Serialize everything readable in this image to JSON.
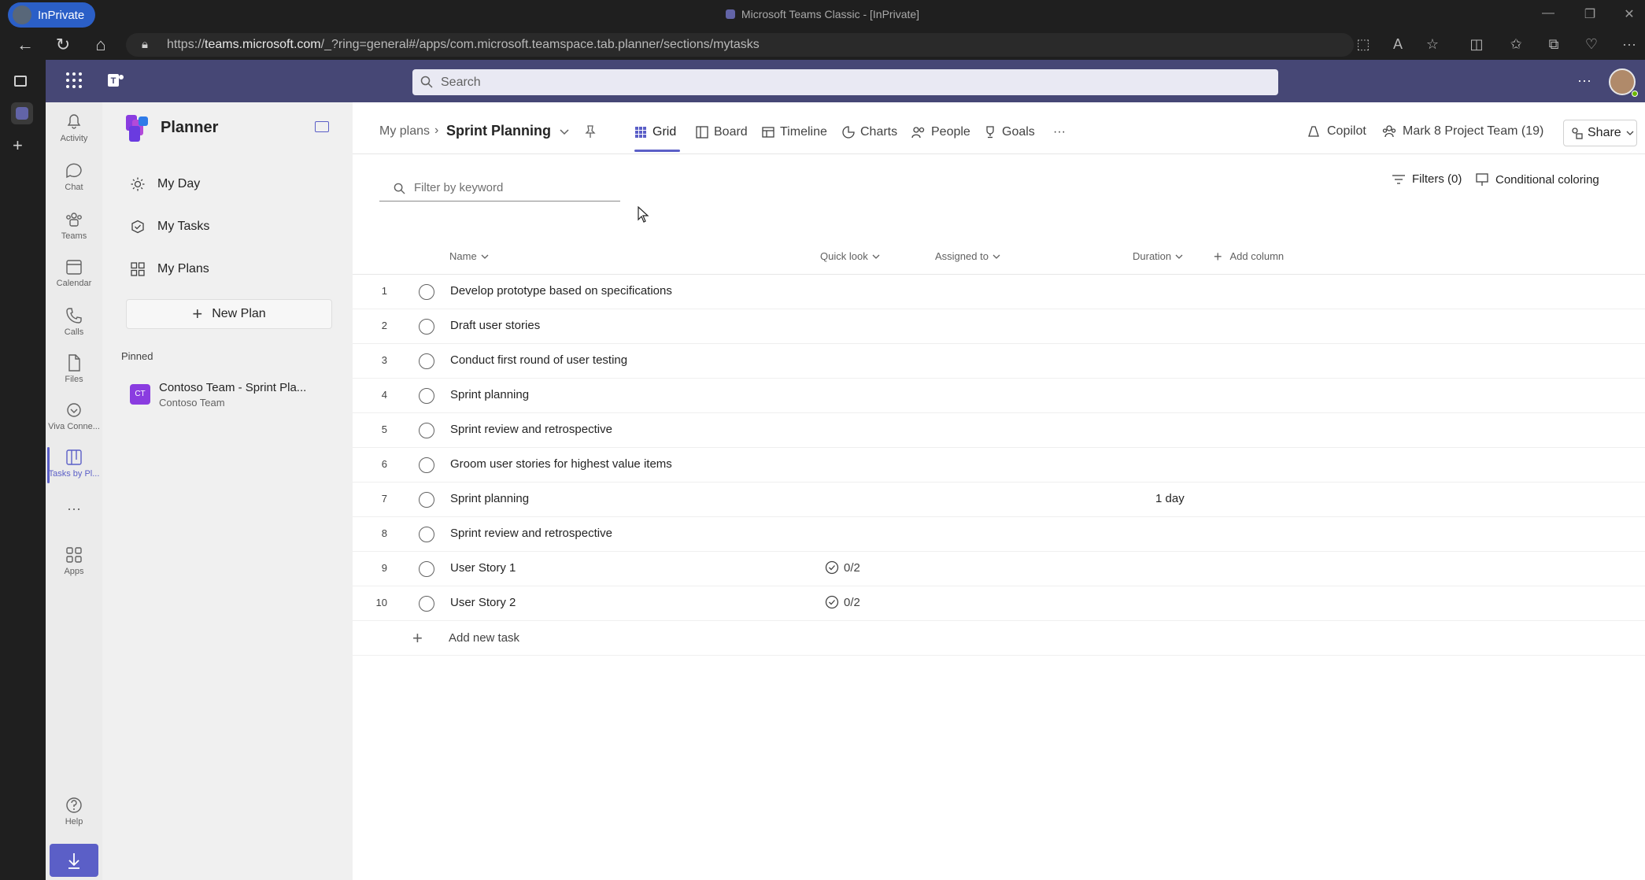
{
  "browser": {
    "inprivate_label": "InPrivate",
    "window_title": "Microsoft Teams Classic - [InPrivate]",
    "url_prefix": "https://",
    "url_host": "teams.microsoft.com",
    "url_path": "/_?ring=general#/apps/com.microsoft.teamspace.tab.planner/sections/mytasks"
  },
  "teams": {
    "search_placeholder": "Search",
    "rail": [
      {
        "label": "Activity",
        "icon": "bell-icon"
      },
      {
        "label": "Chat",
        "icon": "chat-icon"
      },
      {
        "label": "Teams",
        "icon": "teams-icon"
      },
      {
        "label": "Calendar",
        "icon": "calendar-icon"
      },
      {
        "label": "Calls",
        "icon": "phone-icon"
      },
      {
        "label": "Files",
        "icon": "file-icon"
      },
      {
        "label": "Viva Conne...",
        "icon": "viva-icon"
      },
      {
        "label": "Tasks by Pl...",
        "icon": "tasks-icon"
      },
      {
        "label": "Apps",
        "icon": "apps-icon"
      },
      {
        "label": "Help",
        "icon": "help-icon"
      }
    ],
    "more_label": "···"
  },
  "sidebar": {
    "app_title": "Planner",
    "nav": [
      {
        "label": "My Day",
        "icon": "sun-icon"
      },
      {
        "label": "My Tasks",
        "icon": "tasks-icon"
      },
      {
        "label": "My Plans",
        "icon": "grid-icon"
      }
    ],
    "new_plan_label": "New Plan",
    "pinned_heading": "Pinned",
    "pinned_item": {
      "title": "Contoso Team - Sprint Pla...",
      "subtitle": "Contoso Team",
      "badge": "CT"
    }
  },
  "header": {
    "breadcrumb_root": "My plans",
    "plan_title": "Sprint Planning",
    "tabs": [
      "Grid",
      "Board",
      "Timeline",
      "Charts",
      "People",
      "Goals"
    ],
    "more": "···",
    "copilot_label": "Copilot",
    "team_label": "Mark 8 Project Team (19)",
    "share_label": "Share"
  },
  "toolbar": {
    "filter_placeholder": "Filter by keyword",
    "filters_label": "Filters (0)",
    "conditional_label": "Conditional coloring"
  },
  "grid": {
    "columns": {
      "name": "Name",
      "quick_look": "Quick look",
      "assigned_to": "Assigned to",
      "duration": "Duration",
      "add_column": "Add column"
    },
    "rows": [
      {
        "num": "1",
        "name": "Develop prototype based on specifications",
        "quick_look": "",
        "duration": ""
      },
      {
        "num": "2",
        "name": "Draft user stories",
        "quick_look": "",
        "duration": ""
      },
      {
        "num": "3",
        "name": "Conduct first round of user testing",
        "quick_look": "",
        "duration": ""
      },
      {
        "num": "4",
        "name": "Sprint planning",
        "quick_look": "",
        "duration": ""
      },
      {
        "num": "5",
        "name": "Sprint review and retrospective",
        "quick_look": "",
        "duration": ""
      },
      {
        "num": "6",
        "name": "Groom user stories for highest value items",
        "quick_look": "",
        "duration": ""
      },
      {
        "num": "7",
        "name": "Sprint planning",
        "quick_look": "",
        "duration": "1 day"
      },
      {
        "num": "8",
        "name": "Sprint review and retrospective",
        "quick_look": "",
        "duration": ""
      },
      {
        "num": "9",
        "name": "User Story 1",
        "quick_look": "0/2",
        "duration": ""
      },
      {
        "num": "10",
        "name": "User Story 2",
        "quick_look": "0/2",
        "duration": ""
      }
    ],
    "add_task_label": "Add new task"
  },
  "colors": {
    "accent": "#5b5fc7",
    "teams_header": "#464775",
    "inprivate": "#2b5fc7"
  }
}
